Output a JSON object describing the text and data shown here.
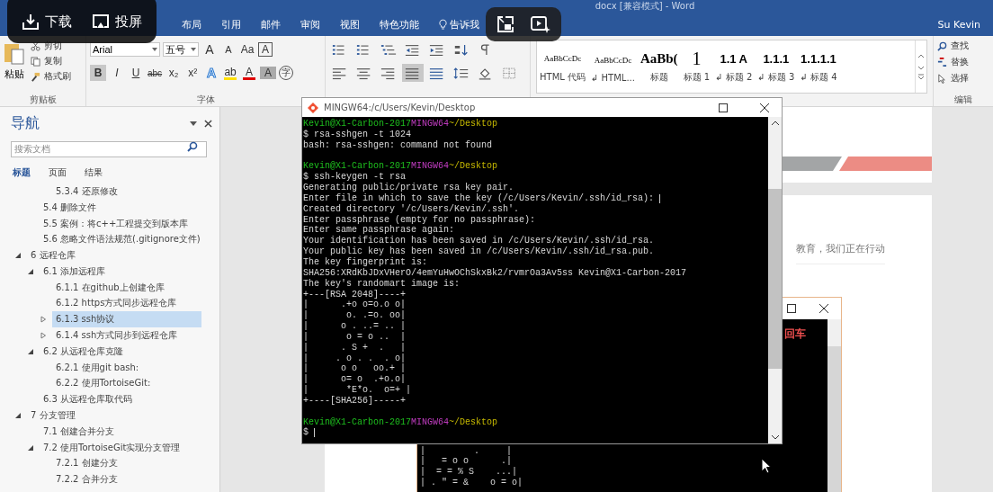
{
  "overlay": {
    "buttons": [
      {
        "kind": "download",
        "label": "下载"
      },
      {
        "kind": "cast",
        "label": "投屏"
      }
    ],
    "tools": [
      {
        "kind": "pip"
      },
      {
        "kind": "magic"
      }
    ]
  },
  "window": {
    "title": "docx [兼容模式] - Word",
    "user": "Su Kevin"
  },
  "tabs": [
    {
      "label": "布局",
      "selected": false
    },
    {
      "label": "引用",
      "selected": false
    },
    {
      "label": "邮件",
      "selected": false
    },
    {
      "label": "审阅",
      "selected": false
    },
    {
      "label": "视图",
      "selected": false
    },
    {
      "label": "特色功能",
      "selected": false
    },
    {
      "label": "告诉我",
      "selected": false,
      "kind": "tell"
    }
  ],
  "ribbon": {
    "clipboard": {
      "paste": "粘贴",
      "items": [
        {
          "kind": "cut",
          "label": "剪切"
        },
        {
          "kind": "copy",
          "label": "复制"
        },
        {
          "kind": "brush",
          "label": "格式刷"
        }
      ],
      "title": "剪贴板"
    },
    "font": {
      "name": "Arial",
      "size": "五号",
      "row1": [
        {
          "glyph": "A",
          "kind": "grow"
        },
        {
          "glyph": "A",
          "kind": "shrink"
        },
        {
          "glyph": "Aa",
          "kind": "case"
        },
        {
          "glyph": "A",
          "kind": "outline"
        }
      ],
      "row2": [
        {
          "glyph": "B",
          "kind": "bold",
          "selected": true
        },
        {
          "glyph": "I",
          "kind": "italic",
          "selected": false
        },
        {
          "glyph": "U",
          "kind": "underline",
          "selected": false
        },
        {
          "glyph": "abc",
          "kind": "strike",
          "selected": false
        },
        {
          "glyph": "x₂",
          "kind": "plain",
          "selected": false
        },
        {
          "glyph": "x²",
          "kind": "plain",
          "selected": false
        },
        {
          "glyph": "A",
          "kind": "effect",
          "selected": false
        },
        {
          "glyph": "ab",
          "kind": "colorbar",
          "color": "#ffe000",
          "selected": false
        },
        {
          "glyph": "A",
          "kind": "colorbar",
          "color": "#e00000",
          "selected": false
        },
        {
          "glyph": "A",
          "kind": "shaded",
          "selected": false
        },
        {
          "glyph": "字",
          "kind": "circle",
          "selected": false
        }
      ],
      "title": "字体"
    },
    "paragraph": {
      "row1": [
        {
          "kind": "bullets",
          "selected": false
        },
        {
          "kind": "numbering",
          "selected": false
        },
        {
          "kind": "multilevel",
          "selected": false
        },
        {
          "kind": "outdent",
          "selected": false
        },
        {
          "kind": "indent",
          "selected": false
        },
        {
          "kind": "sort",
          "selected": false
        },
        {
          "kind": "marks",
          "selected": false
        }
      ],
      "row2": [
        {
          "kind": "align-left",
          "selected": false
        },
        {
          "kind": "align-center",
          "selected": false
        },
        {
          "kind": "align-right",
          "selected": false
        },
        {
          "kind": "justify",
          "selected": true
        },
        {
          "kind": "distribute",
          "selected": false
        },
        {
          "kind": "spacing",
          "selected": false
        },
        {
          "kind": "shading",
          "selected": false
        },
        {
          "kind": "borders",
          "selected": false
        }
      ]
    },
    "styles": [
      {
        "preview": "AaBbCcDc",
        "label": "HTML 代码",
        "kind": "code",
        "selected": false
      },
      {
        "preview": "AaBbCcDc",
        "label": "↲ HTML...",
        "kind": "code",
        "selected": false
      },
      {
        "preview": "AaBb(",
        "label": "标题",
        "kind": "title",
        "selected": false
      },
      {
        "preview": "1",
        "label": "标题 1",
        "kind": "h1",
        "selected": false
      },
      {
        "preview": "1.1 A",
        "label": "↲ 标题 2",
        "kind": "h2",
        "selected": false
      },
      {
        "preview": "1.1.1",
        "label": "↲ 标题 3",
        "kind": "h2",
        "selected": false
      },
      {
        "preview": "1.1.1.1",
        "label": "↲ 标题 4",
        "kind": "h2",
        "selected": false
      }
    ],
    "editing": {
      "items": [
        {
          "kind": "find",
          "label": "查找"
        },
        {
          "kind": "replace",
          "label": "替换"
        },
        {
          "kind": "select",
          "label": "选择"
        }
      ],
      "title": "编辑"
    }
  },
  "nav": {
    "title": "导航",
    "search": {
      "placeholder": "搜索文档"
    },
    "tabs": [
      {
        "label": "标题",
        "selected": true
      },
      {
        "label": "页面",
        "selected": false
      },
      {
        "label": "结果",
        "selected": false
      }
    ],
    "tree": [
      {
        "children": [
          {
            "children": [
              {
                "label": "5.3.4 还原修改",
                "selected": false
              }
            ]
          },
          {
            "label": "5.4 删除文件",
            "selected": false
          },
          {
            "label": "5.5 案例：将c++工程提交到版本库",
            "selected": false
          },
          {
            "label": "5.6 忽略文件语法规范(.gitignore文件)",
            "selected": false
          }
        ]
      },
      {
        "label": "6 远程仓库",
        "selected": false,
        "expanded": true,
        "children": [
          {
            "label": "6.1 添加远程库",
            "selected": false,
            "expanded": true,
            "children": [
              {
                "label": "6.1.1 在github上创建仓库",
                "selected": false
              },
              {
                "label": "6.1.2 https方式同步远程仓库",
                "selected": false
              },
              {
                "label": "6.1.3 ssh协议",
                "selected": true,
                "expanded": false
              },
              {
                "label": "6.1.4 ssh方式同步到远程仓库",
                "selected": false,
                "expanded": false
              }
            ]
          },
          {
            "label": "6.2 从远程仓库克隆",
            "selected": false,
            "expanded": true,
            "children": [
              {
                "label": "6.2.1 使用git bash:",
                "selected": false
              },
              {
                "label": "6.2.2 使用TortoiseGit:",
                "selected": false
              }
            ]
          },
          {
            "label": "6.3 从远程仓库取代码",
            "selected": false
          }
        ]
      },
      {
        "label": "7 分支管理",
        "selected": false,
        "expanded": true,
        "children": [
          {
            "label": "7.1 创建合并分支",
            "selected": false
          },
          {
            "label": "7.2 使用TortoiseGit实现分支管理",
            "selected": false,
            "expanded": true,
            "children": [
              {
                "label": "7.2.1 创建分支",
                "selected": false
              },
              {
                "label": "7.2.2 合并分支",
                "selected": false
              }
            ]
          }
        ]
      }
    ]
  },
  "document": {
    "tagline": "教育，我们正在行动"
  },
  "back_terminal": {
    "note": "回车",
    "lines": [
      "|         .     |",
      "|   = o o      .|",
      "|  = = % S    ...|",
      "| . \" = &    o = o|"
    ]
  },
  "terminal": {
    "title": "MINGW64:/c/Users/Kevin/Desktop",
    "lines": [
      {
        "kind": "prompt",
        "user": "Kevin@X1-Carbon-2017",
        "env": "MINGW64",
        "path": "~/Desktop"
      },
      {
        "kind": "text",
        "text": "$ rsa-sshgen -t 1024"
      },
      {
        "kind": "text",
        "text": "bash: rsa-sshgen: command not found"
      },
      {
        "kind": "blank"
      },
      {
        "kind": "prompt",
        "user": "Kevin@X1-Carbon-2017",
        "env": "MINGW64",
        "path": "~/Desktop"
      },
      {
        "kind": "text",
        "text": "$ ssh-keygen -t rsa"
      },
      {
        "kind": "text",
        "text": "Generating public/private rsa key pair."
      },
      {
        "kind": "text",
        "text": "Enter file in which to save the key (/c/Users/Kevin/.ssh/id_rsa):",
        "cursor": true
      },
      {
        "kind": "text",
        "text": "Created directory '/c/Users/Kevin/.ssh'."
      },
      {
        "kind": "text",
        "text": "Enter passphrase (empty for no passphrase):"
      },
      {
        "kind": "text",
        "text": "Enter same passphrase again:"
      },
      {
        "kind": "text",
        "text": "Your identification has been saved in /c/Users/Kevin/.ssh/id_rsa."
      },
      {
        "kind": "text",
        "text": "Your public key has been saved in /c/Users/Kevin/.ssh/id_rsa.pub."
      },
      {
        "kind": "text",
        "text": "The key fingerprint is:"
      },
      {
        "kind": "text",
        "text": "SHA256:XRdKbJDxVHerO/4emYuHwOChSkxBk2/rvmrOa3Av5ss Kevin@X1-Carbon-2017"
      },
      {
        "kind": "text",
        "text": "The key's randomart image is:"
      },
      {
        "kind": "text",
        "text": "+---[RSA 2048]----+"
      },
      {
        "kind": "text",
        "text": "|      .+o o=o.o o|"
      },
      {
        "kind": "text",
        "text": "|       o. .=o. oo|"
      },
      {
        "kind": "text",
        "text": "|      o . ..= .. |"
      },
      {
        "kind": "text",
        "text": "|       o = o ..  |"
      },
      {
        "kind": "text",
        "text": "|      . S +  .   |"
      },
      {
        "kind": "text",
        "text": "|     . o . .  . o|"
      },
      {
        "kind": "text",
        "text": "|      o o   oo.+ |"
      },
      {
        "kind": "text",
        "text": "|      o= o  .+o.o|"
      },
      {
        "kind": "text",
        "text": "|       *E*o.  o=+ |"
      },
      {
        "kind": "text",
        "text": "+----[SHA256]-----+"
      },
      {
        "kind": "blank"
      },
      {
        "kind": "prompt",
        "user": "Kevin@X1-Carbon-2017",
        "env": "MINGW64",
        "path": "~/Desktop"
      },
      {
        "kind": "text",
        "text": "$",
        "cursor": true
      }
    ]
  }
}
